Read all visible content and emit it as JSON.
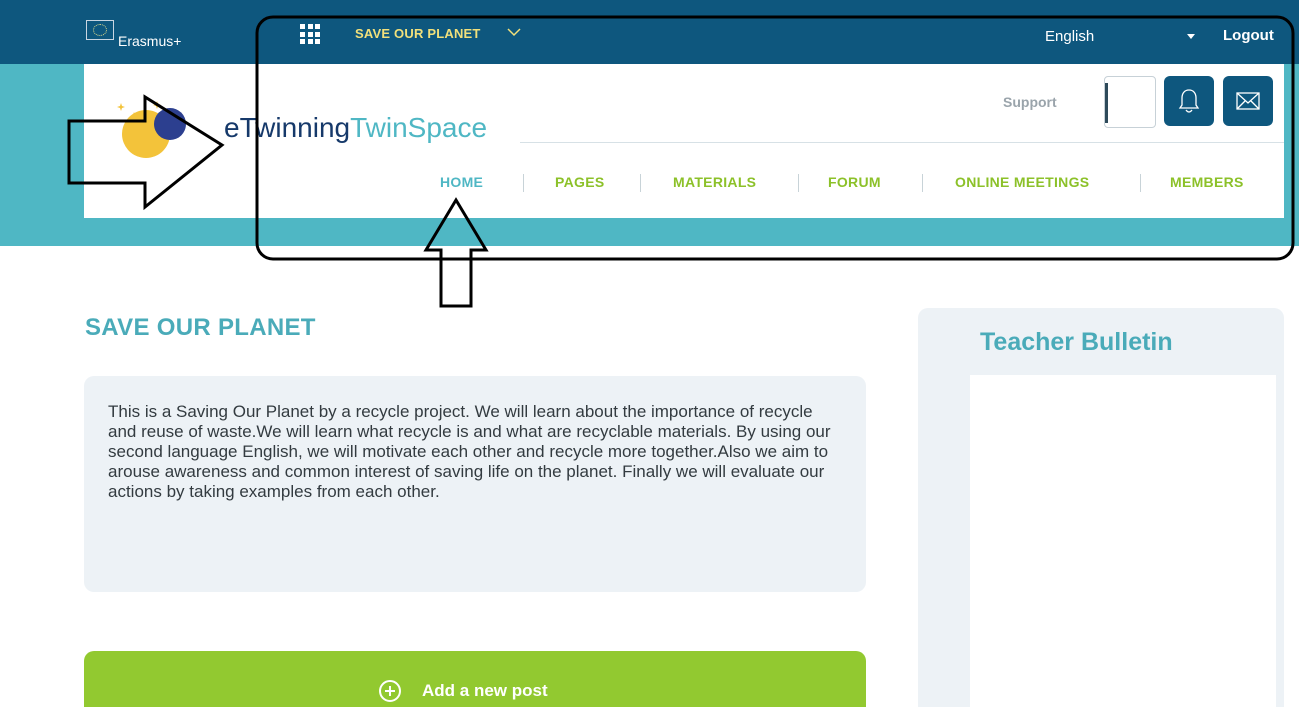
{
  "topbar": {
    "program_label": "Erasmus+",
    "project_title": "SAVE OUR PLANET",
    "language": "English",
    "logout": "Logout"
  },
  "header": {
    "brand_part1": "eTwinning",
    "brand_part2": "TwinSpace",
    "support": "Support"
  },
  "nav": {
    "items": [
      {
        "label": "HOME"
      },
      {
        "label": "PAGES"
      },
      {
        "label": "MATERIALS"
      },
      {
        "label": "FORUM"
      },
      {
        "label": "ONLINE MEETINGS"
      },
      {
        "label": "MEMBERS"
      }
    ],
    "active": "HOME"
  },
  "main": {
    "title": "SAVE OUR PLANET",
    "description": "This is a Saving Our Planet by a recycle project. We will learn about the importance of recycle and reuse of waste.We will learn what recycle is and what are recyclable materials. By using our second language English, we will motivate each other and recycle more together.Also we aim to arouse awareness and common interest of saving life on the planet. Finally we will evaluate our actions by taking examples from each other.",
    "add_post_label": "Add a new post"
  },
  "sidebar": {
    "bulletin_title": "Teacher Bulletin"
  },
  "icons": {
    "apps": "grid-icon",
    "chevron": "chevron-down-icon",
    "language_caret": "caret-down-icon",
    "bell": "bell-icon",
    "mail": "mail-icon",
    "add": "plus-circle-icon"
  },
  "colors": {
    "topbar": "#0e577e",
    "teal": "#4fb7c4",
    "nav_green": "#8cc129",
    "post_green": "#92c930",
    "card_bg": "#edf2f6"
  }
}
